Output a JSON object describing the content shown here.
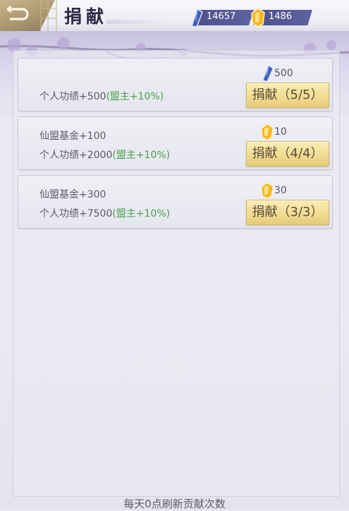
{
  "header": {
    "title": "捐献",
    "back_icon": "back-arrow-icon",
    "currencies": [
      {
        "icon": "blue-crystal-icon",
        "value": "14657"
      },
      {
        "icon": "gold-gem-icon",
        "value": "1486"
      }
    ]
  },
  "donations": [
    {
      "lines": [],
      "personal_label": "个人功绩+500",
      "bonus": "(盟主+10%)",
      "cost_icon": "blue-crystal-icon",
      "cost": "500",
      "button_label": "捐献（5/5）"
    },
    {
      "fund_label": "仙盟基金+100",
      "personal_label": "个人功绩+2000",
      "bonus": "(盟主+10%)",
      "cost_icon": "gold-gem-icon",
      "cost": "10",
      "button_label": "捐献（4/4）"
    },
    {
      "fund_label": "仙盟基金+300",
      "personal_label": "个人功绩+7500",
      "bonus": "(盟主+10%)",
      "cost_icon": "gold-gem-icon",
      "cost": "30",
      "button_label": "捐献（3/3）"
    }
  ],
  "footer": {
    "note": "每天0点刷新贡献次数"
  },
  "colors": {
    "bonus": "#4aa14c",
    "button": "#f2dc93",
    "currency_bar": "#4c4f86"
  }
}
